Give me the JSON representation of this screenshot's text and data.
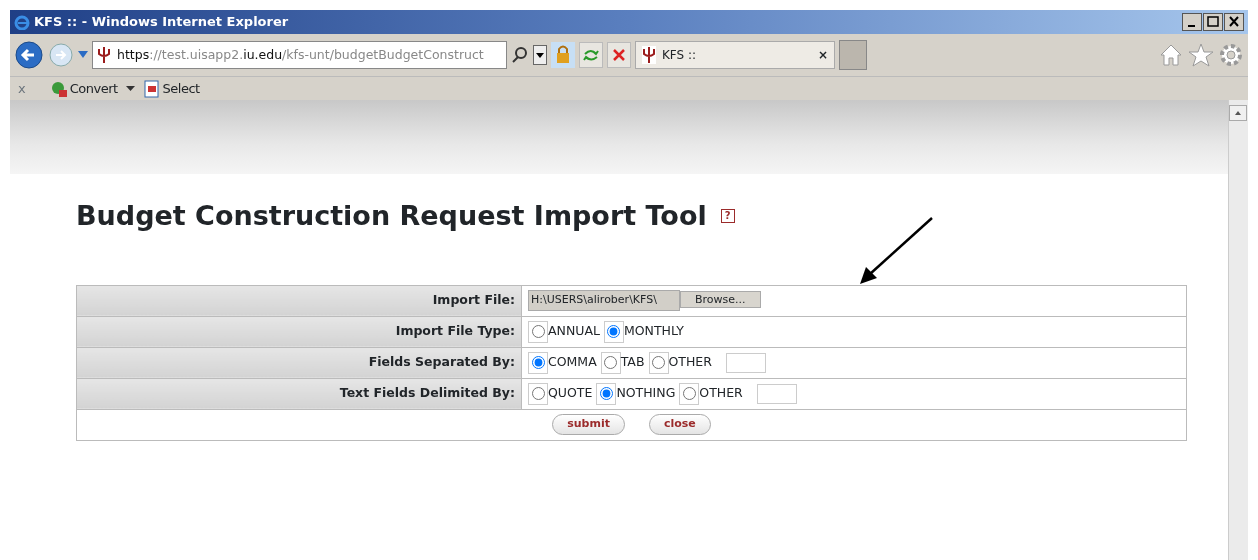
{
  "window": {
    "title": "KFS :: - Windows Internet Explorer"
  },
  "address_bar": {
    "url_parts": [
      {
        "text": "https",
        "emphasis": true
      },
      {
        "text": "://test.uisapp2.",
        "emphasis": false
      },
      {
        "text": "iu.edu",
        "emphasis": true
      },
      {
        "text": "/kfs-unt/budgetBudgetConstruct",
        "emphasis": false
      }
    ]
  },
  "tabs": [
    {
      "label": "KFS ::",
      "close": "×",
      "selected": true
    }
  ],
  "command_bar": {
    "close": "x",
    "items": [
      {
        "label": "Convert",
        "dropdown": true
      },
      {
        "label": "Select",
        "dropdown": false
      }
    ]
  },
  "page": {
    "heading": "Budget Construction Request Import Tool",
    "help": "?",
    "form_rows": [
      {
        "kind": "file",
        "label": "Import File:",
        "value": "H:\\USERS\\alirober\\KFS\\",
        "button": "Browse..."
      },
      {
        "kind": "radio",
        "label": "Import File Type:",
        "options": [
          {
            "label": "ANNUAL",
            "selected": false
          },
          {
            "label": "MONTHLY",
            "selected": true
          }
        ]
      },
      {
        "kind": "radio",
        "label": "Fields Separated By:",
        "options": [
          {
            "label": "COMMA",
            "selected": true
          },
          {
            "label": "TAB",
            "selected": false
          },
          {
            "label": "OTHER",
            "selected": false
          }
        ],
        "other_field": true
      },
      {
        "kind": "radio",
        "label": "Text Fields Delimited By:",
        "options": [
          {
            "label": "QUOTE",
            "selected": false
          },
          {
            "label": "NOTHING",
            "selected": true
          },
          {
            "label": "OTHER",
            "selected": false
          }
        ],
        "other_field": true
      }
    ],
    "buttons": [
      "submit",
      "close"
    ]
  }
}
